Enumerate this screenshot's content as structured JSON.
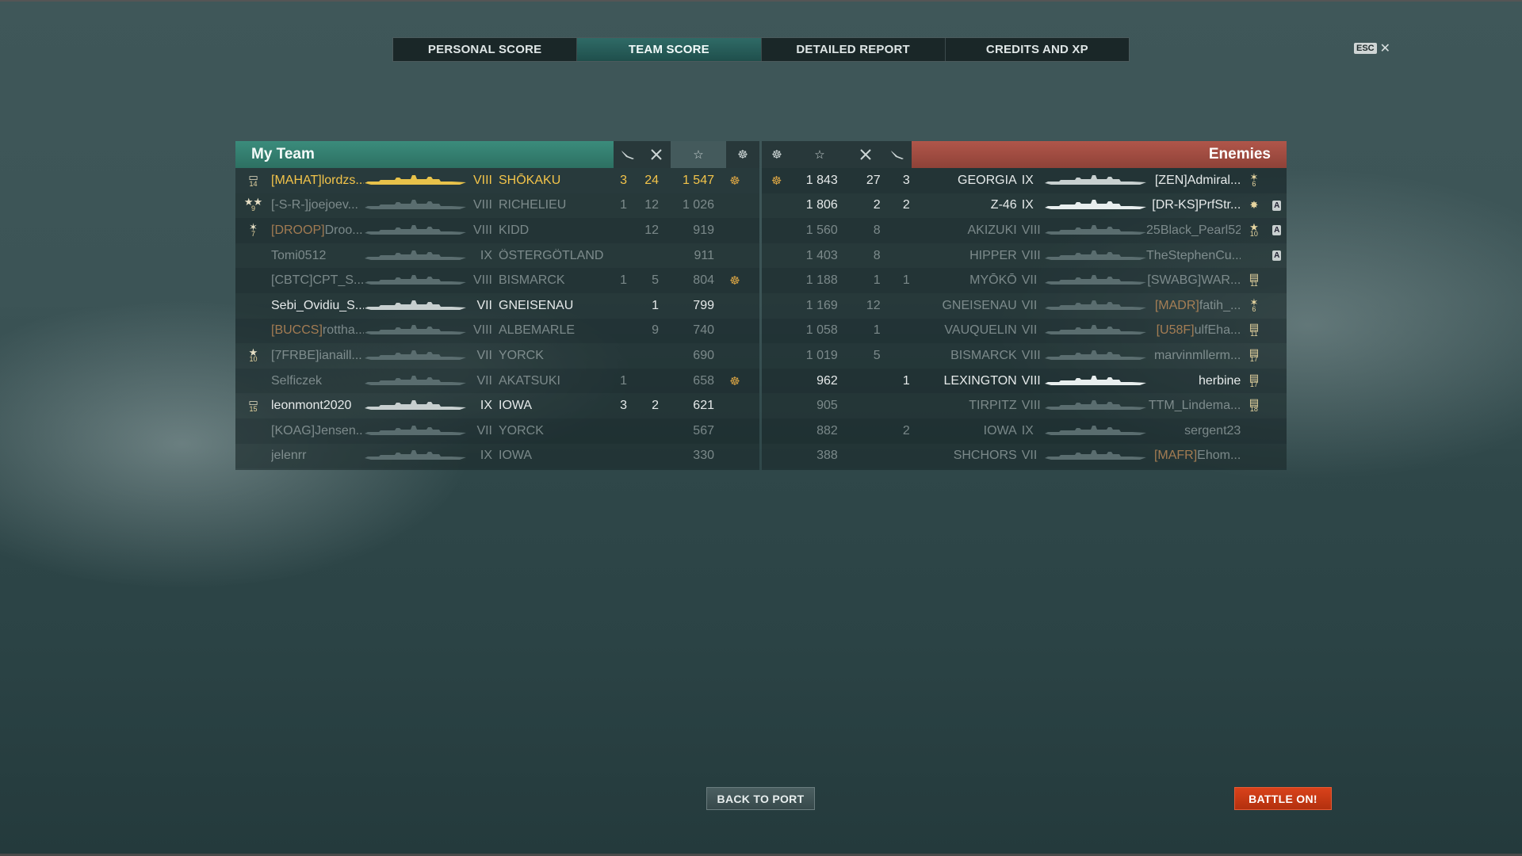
{
  "tabs": [
    "PERSONAL SCORE",
    "TEAM SCORE",
    "DETAILED REPORT",
    "CREDITS AND XP"
  ],
  "active_tab": 1,
  "esc": {
    "key": "ESC",
    "close": "✕"
  },
  "my_team": {
    "title": "My Team",
    "header_icons": [
      "plane-icon",
      "swords-icon",
      "star-icon",
      "base-capture-icon"
    ],
    "rows": [
      {
        "rank_icon": "▭",
        "rank": "14",
        "clan": "[MAHAT]",
        "clan_color": "white",
        "name": "lordzs...",
        "tier": "VIII",
        "ship": "SHŌKAKU",
        "planes": "3",
        "kills": "24",
        "xp": "1 547",
        "cap": "☸",
        "style": "gold",
        "ship_color": "#e8c24a"
      },
      {
        "rank_icon": "★★",
        "rank": "9",
        "clan": "[-S-R-]",
        "clan_color": "white",
        "name": "joejoev...",
        "tier": "VIII",
        "ship": "RICHELIEU",
        "planes": "1",
        "kills": "12",
        "xp": "1 026",
        "cap": "",
        "style": "dim",
        "ship_color": "#5a6d6f"
      },
      {
        "rank_icon": "✶",
        "rank": "7",
        "clan": "[DROOP]",
        "clan_color": "orange",
        "name": "Droo...",
        "tier": "VIII",
        "ship": "KIDD",
        "planes": "",
        "kills": "12",
        "xp": "919",
        "cap": "",
        "style": "dim",
        "ship_color": "#5a6d6f"
      },
      {
        "rank_icon": "",
        "rank": "",
        "clan": "",
        "clan_color": "white",
        "name": "Tomi0512",
        "tier": "IX",
        "ship": "ÖSTERGÖTLAND",
        "planes": "",
        "kills": "",
        "xp": "911",
        "cap": "",
        "style": "dim",
        "ship_color": "#5a6d6f"
      },
      {
        "rank_icon": "",
        "rank": "",
        "clan": "[CBTC]",
        "clan_color": "white",
        "name": "CPT_S...",
        "tier": "VIII",
        "ship": "BISMARCK",
        "planes": "1",
        "kills": "5",
        "xp": "804",
        "cap": "☸",
        "style": "dim",
        "ship_color": "#5a6d6f"
      },
      {
        "rank_icon": "",
        "rank": "",
        "clan": "",
        "clan_color": "white",
        "name": "Sebi_Ovidiu_S...",
        "tier": "VII",
        "ship": "GNEISENAU",
        "planes": "",
        "kills": "1",
        "xp": "799",
        "cap": "",
        "style": "normal",
        "ship_color": "#c7cfcf"
      },
      {
        "rank_icon": "",
        "rank": "",
        "clan": "[BUCCS]",
        "clan_color": "orange",
        "name": "rottha...",
        "tier": "VIII",
        "ship": "ALBEMARLE",
        "planes": "",
        "kills": "9",
        "xp": "740",
        "cap": "",
        "style": "dim",
        "ship_color": "#5a6d6f"
      },
      {
        "rank_icon": "★",
        "rank": "10",
        "clan": "[7FRBE]",
        "clan_color": "white",
        "name": "ianaill...",
        "tier": "VII",
        "ship": "YORCK",
        "planes": "",
        "kills": "",
        "xp": "690",
        "cap": "",
        "style": "dim",
        "ship_color": "#5a6d6f"
      },
      {
        "rank_icon": "",
        "rank": "",
        "clan": "",
        "clan_color": "white",
        "name": "Selficzek",
        "tier": "VII",
        "ship": "AKATSUKI",
        "planes": "1",
        "kills": "",
        "xp": "658",
        "cap": "☸",
        "style": "dim",
        "ship_color": "#5a6d6f"
      },
      {
        "rank_icon": "▭",
        "rank": "15",
        "clan": "",
        "clan_color": "white",
        "name": "leonmont2020",
        "tier": "IX",
        "ship": "IOWA",
        "planes": "3",
        "kills": "2",
        "xp": "621",
        "cap": "",
        "style": "normal",
        "ship_color": "#c7cfcf"
      },
      {
        "rank_icon": "",
        "rank": "",
        "clan": "[KOAG]",
        "clan_color": "white",
        "name": "Jensen...",
        "tier": "VII",
        "ship": "YORCK",
        "planes": "",
        "kills": "",
        "xp": "567",
        "cap": "",
        "style": "dim",
        "ship_color": "#5a6d6f"
      },
      {
        "rank_icon": "",
        "rank": "",
        "clan": "",
        "clan_color": "white",
        "name": "jelenrr",
        "tier": "IX",
        "ship": "IOWA",
        "planes": "",
        "kills": "",
        "xp": "330",
        "cap": "",
        "style": "dim",
        "ship_color": "#5a6d6f"
      }
    ]
  },
  "enemies": {
    "title": "Enemies",
    "header_icons": [
      "base-capture-icon",
      "star-icon",
      "swords-icon",
      "plane-icon"
    ],
    "rows": [
      {
        "cap": "☸",
        "xp": "1 843",
        "kills": "27",
        "planes": "3",
        "ship": "GEORGIA",
        "tier": "IX",
        "clan": "[ZEN]",
        "clan_color": "white",
        "name": "Admiral...",
        "rank_icon": "✶",
        "rank": "6",
        "badge": "",
        "style": "normal",
        "ship_color": "#c7cfcf"
      },
      {
        "cap": "",
        "xp": "1 806",
        "kills": "2",
        "planes": "2",
        "ship": "Z-46",
        "tier": "IX",
        "clan": "[DR-KS]",
        "clan_color": "white",
        "name": "PrfStr...",
        "rank_icon": "✸",
        "rank": "",
        "badge": "A",
        "style": "normal",
        "ship_color": "#e8eeee"
      },
      {
        "cap": "",
        "xp": "1 560",
        "kills": "8",
        "planes": "",
        "ship": "AKIZUKI",
        "tier": "VIII",
        "clan": "",
        "clan_color": "white",
        "name": "25Black_Pearl52",
        "rank_icon": "★",
        "rank": "10",
        "badge": "A",
        "style": "dim",
        "ship_color": "#5a6d6f"
      },
      {
        "cap": "",
        "xp": "1 403",
        "kills": "8",
        "planes": "",
        "ship": "HIPPER",
        "tier": "VIII",
        "clan": "",
        "clan_color": "white",
        "name": "TheStephenCu...",
        "rank_icon": "",
        "rank": "",
        "badge": "A",
        "style": "dim",
        "ship_color": "#5a6d6f"
      },
      {
        "cap": "",
        "xp": "1 188",
        "kills": "1",
        "planes": "1",
        "ship": "MYŌKŌ",
        "tier": "VII",
        "clan": "[SWABG]",
        "clan_color": "white",
        "name": "WAR...",
        "rank_icon": "▤",
        "rank": "11",
        "badge": "",
        "style": "dim",
        "ship_color": "#5a6d6f"
      },
      {
        "cap": "",
        "xp": "1 169",
        "kills": "12",
        "planes": "",
        "ship": "GNEISENAU",
        "tier": "VII",
        "clan": "[MADR]",
        "clan_color": "orange",
        "name": "fatih_...",
        "rank_icon": "✶",
        "rank": "6",
        "badge": "",
        "style": "dim",
        "ship_color": "#5a6d6f"
      },
      {
        "cap": "",
        "xp": "1 058",
        "kills": "1",
        "planes": "",
        "ship": "VAUQUELIN",
        "tier": "VII",
        "clan": "[U58F]",
        "clan_color": "orange",
        "name": "ulfEha...",
        "rank_icon": "▤",
        "rank": "11",
        "badge": "",
        "style": "dim",
        "ship_color": "#5a6d6f"
      },
      {
        "cap": "",
        "xp": "1 019",
        "kills": "5",
        "planes": "",
        "ship": "BISMARCK",
        "tier": "VIII",
        "clan": "",
        "clan_color": "white",
        "name": "marvinmllerm...",
        "rank_icon": "▤",
        "rank": "17",
        "badge": "",
        "style": "dim",
        "ship_color": "#5a6d6f"
      },
      {
        "cap": "",
        "xp": "962",
        "kills": "",
        "planes": "1",
        "ship": "LEXINGTON",
        "tier": "VIII",
        "clan": "",
        "clan_color": "white",
        "name": "herbine",
        "rank_icon": "▤",
        "rank": "17",
        "badge": "",
        "style": "normal",
        "ship_color": "#e8eeee"
      },
      {
        "cap": "",
        "xp": "905",
        "kills": "",
        "planes": "",
        "ship": "TIRPITZ",
        "tier": "VIII",
        "clan": "",
        "clan_color": "white",
        "name": "TTM_Lindema...",
        "rank_icon": "▤",
        "rank": "18",
        "badge": "",
        "style": "dim",
        "ship_color": "#5a6d6f"
      },
      {
        "cap": "",
        "xp": "882",
        "kills": "",
        "planes": "2",
        "ship": "IOWA",
        "tier": "IX",
        "clan": "",
        "clan_color": "white",
        "name": "sergent23",
        "rank_icon": "",
        "rank": "",
        "badge": "",
        "style": "dim",
        "ship_color": "#5a6d6f"
      },
      {
        "cap": "",
        "xp": "388",
        "kills": "",
        "planes": "",
        "ship": "SHCHORS",
        "tier": "VII",
        "clan": "[MAFR]",
        "clan_color": "orange",
        "name": "Ehom...",
        "rank_icon": "",
        "rank": "",
        "badge": "",
        "style": "dim",
        "ship_color": "#5a6d6f"
      }
    ]
  },
  "buttons": {
    "back": "BACK TO PORT",
    "battle": "BATTLE ON!"
  }
}
